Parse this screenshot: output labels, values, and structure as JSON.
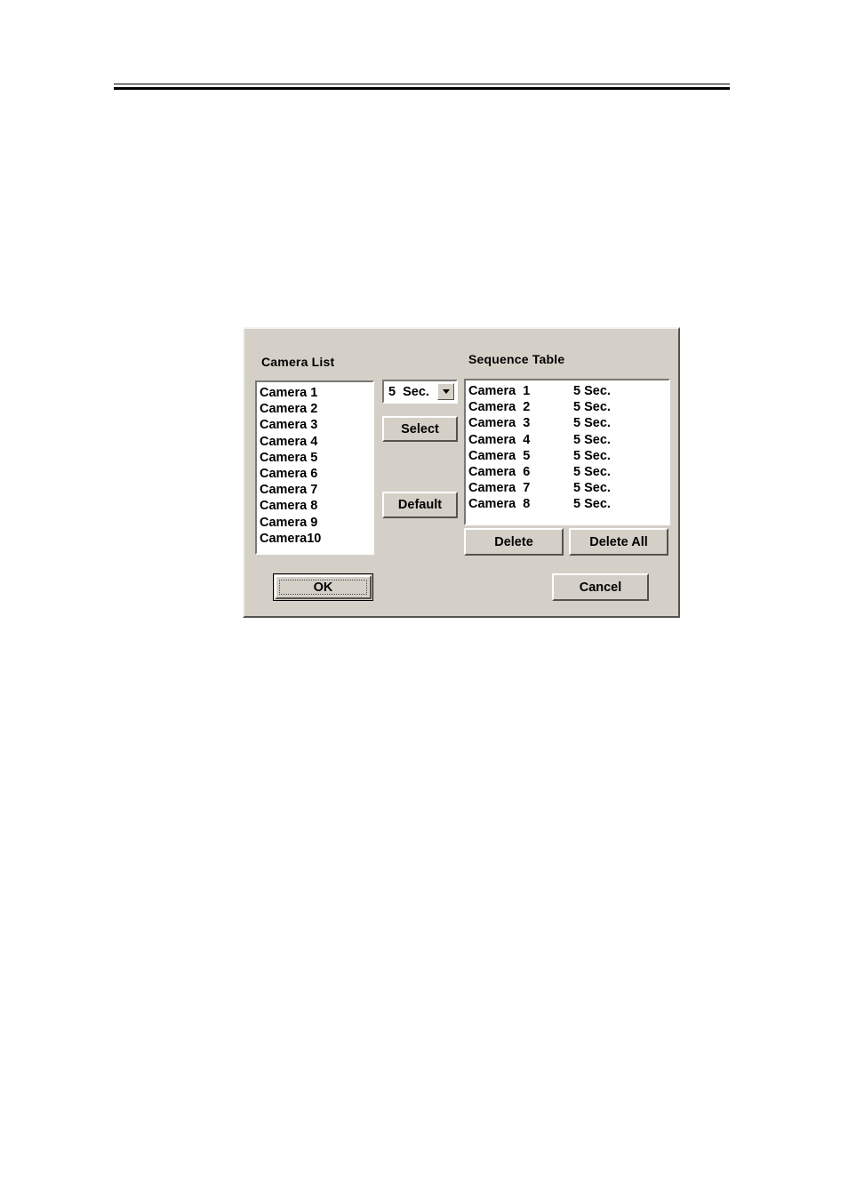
{
  "page": {
    "background_color": "#ffffff",
    "header_rule": {
      "name": "double-horizontal-rule",
      "color": "#000000"
    }
  },
  "dialog": {
    "background_color": "#d4d0c8",
    "camera_list": {
      "label": "Camera List",
      "items": [
        "Camera 1",
        "Camera 2",
        "Camera 3",
        "Camera 4",
        "Camera 5",
        "Camera 6",
        "Camera 7",
        "Camera 8",
        "Camera 9",
        "Camera10"
      ]
    },
    "duration_combo": {
      "name": "duration-dropdown",
      "value": "5  Sec.",
      "arrow_icon": "chevron-down-icon"
    },
    "buttons": {
      "select": "Select",
      "default": "Default",
      "delete": "Delete",
      "delete_all": "Delete All",
      "ok": "OK",
      "cancel": "Cancel"
    },
    "sequence_table": {
      "label": "Sequence Table",
      "rows": [
        {
          "camera": "Camera  1",
          "duration": "5 Sec."
        },
        {
          "camera": "Camera  2",
          "duration": "5 Sec."
        },
        {
          "camera": "Camera  3",
          "duration": "5 Sec."
        },
        {
          "camera": "Camera  4",
          "duration": "5 Sec."
        },
        {
          "camera": "Camera  5",
          "duration": "5 Sec."
        },
        {
          "camera": "Camera  6",
          "duration": "5 Sec."
        },
        {
          "camera": "Camera  7",
          "duration": "5 Sec."
        },
        {
          "camera": "Camera  8",
          "duration": "5 Sec."
        }
      ]
    }
  }
}
